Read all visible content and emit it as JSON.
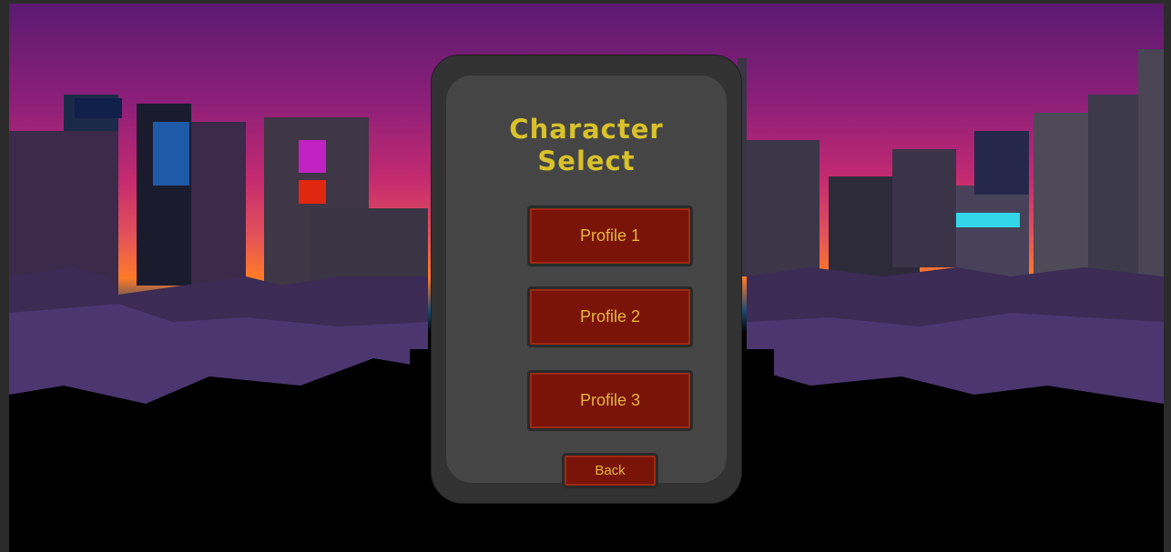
{
  "screen": {
    "title_line1": "Character",
    "title_line2": "Select"
  },
  "profiles": [
    {
      "label": "Profile 1"
    },
    {
      "label": "Profile 2"
    },
    {
      "label": "Profile 3"
    }
  ],
  "back_label": "Back",
  "colors": {
    "title": "#d8c12a",
    "button_fill": "#7a1408",
    "button_text": "#e6b640",
    "panel_outer": "#323232",
    "panel_inner": "#454545",
    "sky_top": "#5e1a6e",
    "sky_horizon": "#ff7a28"
  }
}
